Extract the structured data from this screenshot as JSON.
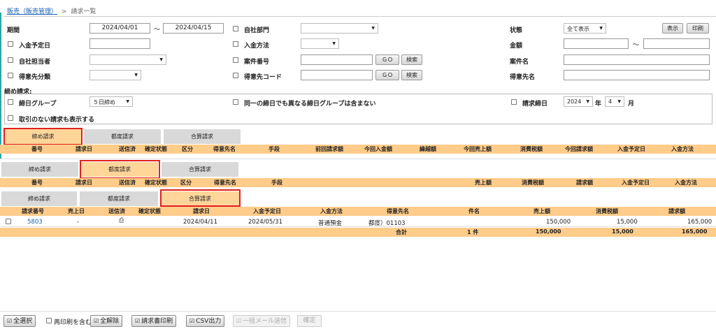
{
  "breadcrumb": {
    "parent": "販売（販売管理）",
    "separator": ">",
    "current": "請求一覧"
  },
  "filters": {
    "period_label": "期間",
    "period_from": "2024/04/01",
    "period_tilde": "～",
    "period_to": "2024/04/15",
    "own_dept_label": "自社部門",
    "status_label": "状態",
    "status_value": "全て表示",
    "display_button": "表示",
    "print_button": "印刷",
    "payment_due_label": "入金予定日",
    "payment_method_label": "入金方法",
    "amount_label": "金額",
    "amount_tilde": "～",
    "staff_label": "自社担当者",
    "project_no_label": "案件番号",
    "go_label": "ＧＯ",
    "search_label": "検索",
    "project_name_label": "案件名",
    "customer_class_label": "得意先分類",
    "customer_code_label": "得意先コード",
    "customer_name_label": "得意先名"
  },
  "closing": {
    "title": "締め請求:",
    "group_label": "締日グループ",
    "group_value": "５日締め",
    "exclude_label": "同一の締日でも異なる締日グループは含まない",
    "closing_day_label": "請求締日",
    "year_value": "2024",
    "year_unit": "年",
    "month_value": "4",
    "month_unit": "月",
    "show_no_txn_label": "取引のない請求も表示する"
  },
  "tabs": {
    "closing": "締め請求",
    "each": "都度請求",
    "combined": "合算請求"
  },
  "section1_headers": [
    "番号",
    "請求日",
    "送信済",
    "確定状態",
    "区分",
    "得意先名",
    "手段",
    "前回請求額",
    "今回入金額",
    "繰越額",
    "今回売上額",
    "消費税額",
    "今回請求額",
    "入金予定日",
    "入金方法"
  ],
  "section2_headers": [
    "番号",
    "請求日",
    "送信済",
    "確定状態",
    "区分",
    "得意先名",
    "手段",
    "売上額",
    "消費税額",
    "請求額",
    "入金予定日",
    "入金方法"
  ],
  "section3_headers": [
    "請求番号",
    "売上日",
    "送信済",
    "確定状態",
    "請求日",
    "入金予定日",
    "入金方法",
    "得意先名",
    "件名",
    "売上額",
    "消費税額",
    "請求額"
  ],
  "section3_row": {
    "no": "5803",
    "sales_date": "-",
    "sent_icon": "printer-icon",
    "confirm": "",
    "bill_date": "2024/04/11",
    "due_date": "2024/05/31",
    "method": "普通預金",
    "customer": "都度）01103",
    "subject": "",
    "sales": "150,000",
    "tax": "15,000",
    "total": "165,000"
  },
  "section3_total": {
    "label": "合計",
    "count": "1 件",
    "sales": "150,000",
    "tax": "15,000",
    "total": "165,000"
  },
  "footer": {
    "select_all": "全選択",
    "include_reprint": "再印刷を含む",
    "deselect_all": "全解除",
    "print_invoice": "請求書印刷",
    "csv_export": "CSV出力",
    "bulk_mail": "一括メール送信",
    "confirm": "確定"
  },
  "colors": {
    "accent_header": "#ffcc8a",
    "active_tab": "#ffd59a",
    "highlight_box": "#e02020",
    "link": "#1a5fb4"
  }
}
